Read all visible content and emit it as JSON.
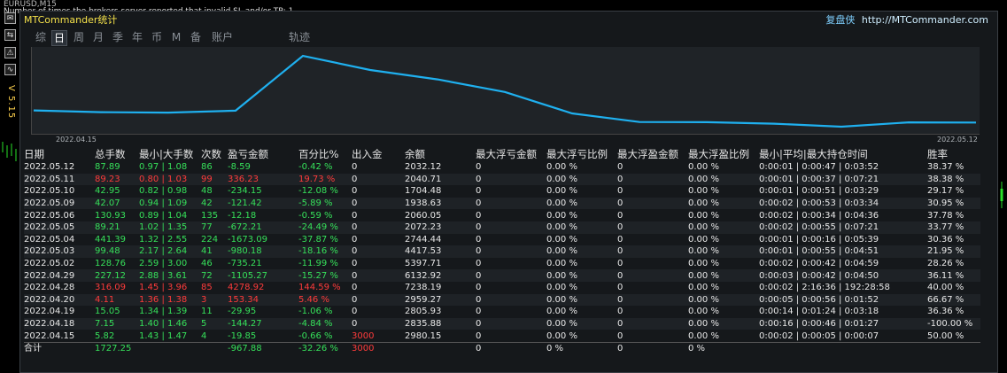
{
  "terminal": {
    "symbol_line": "EURUSD,M15",
    "error_line": "Number of times the brokers server reported that invalid SL and/or TP: 1",
    "version": "V 5.15",
    "side_buttons": [
      "✉",
      "⇆",
      "⚠",
      "∿"
    ]
  },
  "panel": {
    "title": "MTCommander统计",
    "brand_cn": "复盘侠",
    "brand_url": "http://MTCommander.com",
    "tabs": [
      "综",
      "日",
      "周",
      "月",
      "季",
      "年",
      "币",
      "M",
      "备",
      "账户",
      "轨迹"
    ],
    "active_tab": "日"
  },
  "chart_data": {
    "type": "line",
    "x_start_label": "2022.04.15",
    "x_end_label": "2022.05.12",
    "x": [
      "2022.04.15",
      "2022.04.18",
      "2022.04.19",
      "2022.04.20",
      "2022.04.28",
      "2022.04.29",
      "2022.05.02",
      "2022.05.03",
      "2022.05.04",
      "2022.05.05",
      "2022.05.06",
      "2022.05.09",
      "2022.05.10",
      "2022.05.11",
      "2022.05.12"
    ],
    "values": [
      2980.15,
      2835.88,
      2805.93,
      2959.27,
      7238.19,
      6132.92,
      5397.71,
      4417.53,
      2744.44,
      2072.23,
      2060.05,
      1938.63,
      1704.48,
      2040.71,
      2032.12
    ],
    "color": "#1fb0ef"
  },
  "table": {
    "headers": [
      "日期",
      "总手数",
      "最小|大手数",
      "次数",
      "盈亏金额",
      "百分比%",
      "出入金",
      "余额",
      "最大浮亏金额",
      "最大浮亏比例",
      "最大浮盈金额",
      "最大浮盈比例",
      "最小|平均|最大持仓时间",
      "胜率"
    ],
    "rows": [
      {
        "date": "2022.05.12",
        "lots": "87.89",
        "minmax": "0.97 | 1.08",
        "count": "86",
        "pnl": "-8.59",
        "pct": "-0.42 %",
        "flow": "0",
        "balance": "2032.12",
        "mfl": "0",
        "mflp": "0.00 %",
        "mfp": "0",
        "mfpp": "0.00 %",
        "hold": "0:00:01 | 0:00:47 | 0:03:52",
        "win": "38.37 %",
        "neg": true
      },
      {
        "date": "2022.05.11",
        "lots": "89.23",
        "minmax": "0.80 | 1.03",
        "count": "99",
        "pnl": "336.23",
        "pct": "19.73 %",
        "flow": "0",
        "balance": "2040.71",
        "mfl": "0",
        "mflp": "0.00 %",
        "mfp": "0",
        "mfpp": "0.00 %",
        "hold": "0:00:01 | 0:00:37 | 0:07:21",
        "win": "38.38 %",
        "neg": false
      },
      {
        "date": "2022.05.10",
        "lots": "42.95",
        "minmax": "0.82 | 0.98",
        "count": "48",
        "pnl": "-234.15",
        "pct": "-12.08 %",
        "flow": "0",
        "balance": "1704.48",
        "mfl": "0",
        "mflp": "0.00 %",
        "mfp": "0",
        "mfpp": "0.00 %",
        "hold": "0:00:01 | 0:00:51 | 0:03:29",
        "win": "29.17 %",
        "neg": true
      },
      {
        "date": "2022.05.09",
        "lots": "42.07",
        "minmax": "0.94 | 1.09",
        "count": "42",
        "pnl": "-121.42",
        "pct": "-5.89 %",
        "flow": "0",
        "balance": "1938.63",
        "mfl": "0",
        "mflp": "0.00 %",
        "mfp": "0",
        "mfpp": "0.00 %",
        "hold": "0:00:02 | 0:00:53 | 0:03:34",
        "win": "30.95 %",
        "neg": true
      },
      {
        "date": "2022.05.06",
        "lots": "130.93",
        "minmax": "0.89 | 1.04",
        "count": "135",
        "pnl": "-12.18",
        "pct": "-0.59 %",
        "flow": "0",
        "balance": "2060.05",
        "mfl": "0",
        "mflp": "0.00 %",
        "mfp": "0",
        "mfpp": "0.00 %",
        "hold": "0:00:02 | 0:00:34 | 0:04:36",
        "win": "37.78 %",
        "neg": true
      },
      {
        "date": "2022.05.05",
        "lots": "89.21",
        "minmax": "1.02 | 1.35",
        "count": "77",
        "pnl": "-672.21",
        "pct": "-24.49 %",
        "flow": "0",
        "balance": "2072.23",
        "mfl": "0",
        "mflp": "0.00 %",
        "mfp": "0",
        "mfpp": "0.00 %",
        "hold": "0:00:02 | 0:00:55 | 0:07:21",
        "win": "33.77 %",
        "neg": true
      },
      {
        "date": "2022.05.04",
        "lots": "441.39",
        "minmax": "1.32 | 2.55",
        "count": "224",
        "pnl": "-1673.09",
        "pct": "-37.87 %",
        "flow": "0",
        "balance": "2744.44",
        "mfl": "0",
        "mflp": "0.00 %",
        "mfp": "0",
        "mfpp": "0.00 %",
        "hold": "0:00:01 | 0:00:16 | 0:05:39",
        "win": "30.36 %",
        "neg": true
      },
      {
        "date": "2022.05.03",
        "lots": "99.48",
        "minmax": "2.17 | 2.64",
        "count": "41",
        "pnl": "-980.18",
        "pct": "-18.16 %",
        "flow": "0",
        "balance": "4417.53",
        "mfl": "0",
        "mflp": "0.00 %",
        "mfp": "0",
        "mfpp": "0.00 %",
        "hold": "0:00:01 | 0:00:55 | 0:04:51",
        "win": "21.95 %",
        "neg": true
      },
      {
        "date": "2022.05.02",
        "lots": "128.76",
        "minmax": "2.59 | 3.00",
        "count": "46",
        "pnl": "-735.21",
        "pct": "-11.99 %",
        "flow": "0",
        "balance": "5397.71",
        "mfl": "0",
        "mflp": "0.00 %",
        "mfp": "0",
        "mfpp": "0.00 %",
        "hold": "0:00:02 | 0:00:42 | 0:04:59",
        "win": "28.26 %",
        "neg": true
      },
      {
        "date": "2022.04.29",
        "lots": "227.12",
        "minmax": "2.88 | 3.61",
        "count": "72",
        "pnl": "-1105.27",
        "pct": "-15.27 %",
        "flow": "0",
        "balance": "6132.92",
        "mfl": "0",
        "mflp": "0.00 %",
        "mfp": "0",
        "mfpp": "0.00 %",
        "hold": "0:00:03 | 0:00:42 | 0:04:50",
        "win": "36.11 %",
        "neg": true
      },
      {
        "date": "2022.04.28",
        "lots": "316.09",
        "minmax": "1.45 | 3.96",
        "count": "85",
        "pnl": "4278.92",
        "pct": "144.59 %",
        "flow": "0",
        "balance": "7238.19",
        "mfl": "0",
        "mflp": "0.00 %",
        "mfp": "0",
        "mfpp": "0.00 %",
        "hold": "0:00:02 | 2:16:36 | 192:28:58",
        "win": "40.00 %",
        "neg": false
      },
      {
        "date": "2022.04.20",
        "lots": "4.11",
        "minmax": "1.36 | 1.38",
        "count": "3",
        "pnl": "153.34",
        "pct": "5.46 %",
        "flow": "0",
        "balance": "2959.27",
        "mfl": "0",
        "mflp": "0.00 %",
        "mfp": "0",
        "mfpp": "0.00 %",
        "hold": "0:00:05 | 0:00:56 | 0:01:52",
        "win": "66.67 %",
        "neg": false
      },
      {
        "date": "2022.04.19",
        "lots": "15.05",
        "minmax": "1.34 | 1.39",
        "count": "11",
        "pnl": "-29.95",
        "pct": "-1.06 %",
        "flow": "0",
        "balance": "2805.93",
        "mfl": "0",
        "mflp": "0.00 %",
        "mfp": "0",
        "mfpp": "0.00 %",
        "hold": "0:00:14 | 0:01:24 | 0:03:18",
        "win": "36.36 %",
        "neg": true
      },
      {
        "date": "2022.04.18",
        "lots": "7.15",
        "minmax": "1.40 | 1.46",
        "count": "5",
        "pnl": "-144.27",
        "pct": "-4.84 %",
        "flow": "0",
        "balance": "2835.88",
        "mfl": "0",
        "mflp": "0.00 %",
        "mfp": "0",
        "mfpp": "0.00 %",
        "hold": "0:00:16 | 0:00:46 | 0:01:27",
        "win": "-100.00 %",
        "neg": true
      },
      {
        "date": "2022.04.15",
        "lots": "5.82",
        "minmax": "1.43 | 1.47",
        "count": "4",
        "pnl": "-19.85",
        "pct": "-0.66 %",
        "flow": "3000",
        "balance": "2980.15",
        "mfl": "0",
        "mflp": "0.00 %",
        "mfp": "0",
        "mfpp": "0.00 %",
        "hold": "0:00:02 | 0:00:05 | 0:00:07",
        "win": "50.00 %",
        "neg": true,
        "flow_red": true
      }
    ],
    "total": {
      "label": "合计",
      "lots": "1727.25",
      "pnl": "-967.88",
      "pct": "-32.26 %",
      "flow": "3000",
      "mfl": "0",
      "mflp": "0 %",
      "mfp": "0",
      "mfpp": "0 %"
    }
  }
}
